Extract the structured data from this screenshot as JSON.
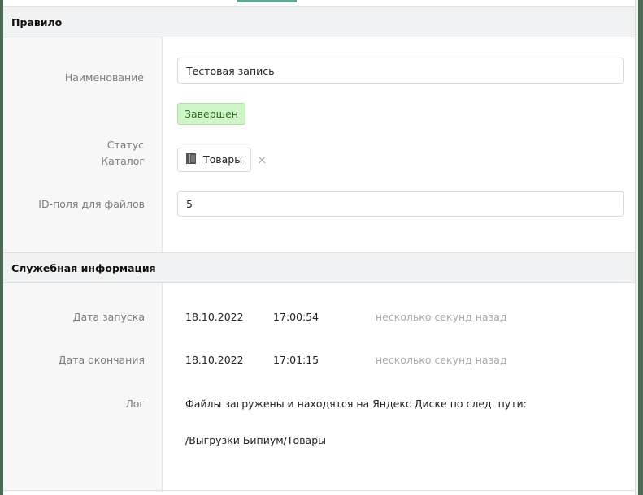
{
  "rule_section": {
    "title": "Правило",
    "name_label": "Наименование",
    "name_value": "Тестовая запись",
    "status_label": "Статус",
    "status_value": "Завершен",
    "catalog_label": "Каталог",
    "catalog_value": "Товары",
    "catalog_icon": "catalog-book-icon",
    "catalog_remove": "×",
    "file_field_label": "ID-поля для файлов",
    "file_field_value": "5"
  },
  "service_section": {
    "title": "Служебная информация",
    "start_label": "Дата запуска",
    "start_date": "18.10.2022",
    "start_time": "17:00:54",
    "start_relative": "несколько секунд назад",
    "end_label": "Дата окончания",
    "end_date": "18.10.2022",
    "end_time": "17:01:15",
    "end_relative": "несколько секунд назад",
    "log_label": "Лог",
    "log_line1": "Файлы загружены и находятся на Яндекс Диске по след. пути:",
    "log_line2": "/Выгрузки Бипиум/Товары"
  },
  "colors": {
    "accent": "#5ea896",
    "status_bg": "#cff5c9",
    "frame": "#4a6b52"
  }
}
